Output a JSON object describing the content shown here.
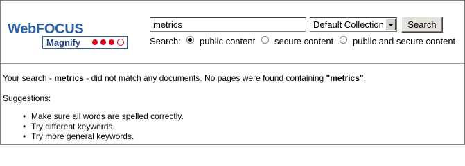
{
  "logo": {
    "brand": "WebFOCUS",
    "product": "Magnify",
    "brand_color": "#2b5fa8",
    "dot_color": "#e0001b"
  },
  "search": {
    "query_value": "metrics",
    "collection_selected": "Default Collection",
    "button_label": "Search"
  },
  "scope": {
    "label": "Search:",
    "options": [
      {
        "label": "public content",
        "checked": true
      },
      {
        "label": "secure content",
        "checked": false
      },
      {
        "label": "public and secure content",
        "checked": false
      }
    ]
  },
  "results": {
    "msg_prefix": "Your search - ",
    "msg_term": "metrics",
    "msg_middle": " - did not match any documents. No pages were found containing ",
    "msg_term_quoted": "\"metrics\"",
    "msg_suffix": ".",
    "suggestions_title": "Suggestions:",
    "tips": [
      "Make sure all words are spelled correctly.",
      "Try different keywords.",
      "Try more general keywords."
    ]
  }
}
